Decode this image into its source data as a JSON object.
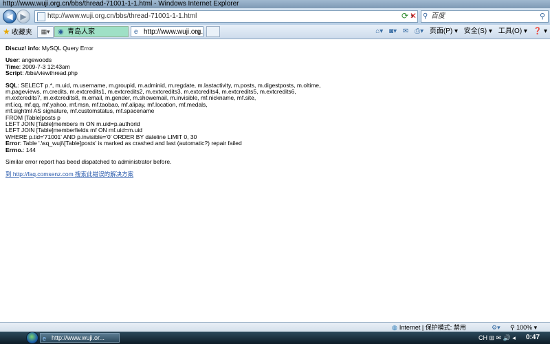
{
  "window": {
    "title": "http://www.wuji.org.cn/bbs/thread-71001-1-1.html - Windows Internet Explorer"
  },
  "nav": {
    "address": "http://www.wuji.org.cn/bbs/thread-71001-1-1.html",
    "search_placeholder": "百度"
  },
  "commandbar": {
    "favorites_label": "收藏夹",
    "tabs": [
      {
        "label": "青岛人家"
      },
      {
        "label": "http://www.wuji.org.cn..."
      }
    ],
    "page_menu": "页面(P) ▾",
    "safety_menu": "安全(S) ▾",
    "tools_menu": "工具(O) ▾",
    "help_menu": "❓ ▾"
  },
  "error": {
    "heading_label": "Discuz! info",
    "heading_value": ": MySQL Query Error",
    "user_label": "User",
    "user_value": ": angewoods",
    "time_label": "Time",
    "time_value": ": 2009-7-3 12:43am",
    "script_label": "Script",
    "script_value": ": /bbs/viewthread.php",
    "sql_label": "SQL",
    "sql_lines": [
      ": SELECT p.*, m.uid, m.username, m.groupid, m.adminid, m.regdate, m.lastactivity, m.posts, m.digestposts, m.oltime,",
      "m.pageviews, m.credits, m.extcredits1, m.extcredits2, m.extcredits3, m.extcredits4, m.extcredits5, m.extcredits6,",
      "m.extcredits7, m.extcredits8, m.email, m.gender, m.showemail, m.invisible, mf.nickname, mf.site,",
      "mf.icq, mf.qq, mf.yahoo, mf.msn, mf.taobao, mf.alipay, mf.location, mf.medals,",
      "mf.sightml AS signature, mf.customstatus, mf.spacename",
      "FROM [Table]posts p",
      "LEFT JOIN [Table]members m ON m.uid=p.authorid",
      "LEFT JOIN [Table]memberfields mf ON mf.uid=m.uid",
      "WHERE p.tid='71001' AND p.invisible='0' ORDER BY dateline LIMIT 0, 30"
    ],
    "error_label": "Error",
    "error_value": ": Table '.\\sq_wuji\\[Table]posts' is marked as crashed and last (automatic?) repair failed",
    "errno_label": "Errno.",
    "errno_value": ": 144",
    "report_text": "Similar error report has beed dispatched to administrator before.",
    "faq_link": "到 http://faq.comsenz.com 搜索此错误的解决方案"
  },
  "statusbar": {
    "zone": "Internet | 保护模式: 禁用",
    "zoom": "100%"
  },
  "taskbar": {
    "task_label": "http://www.wuji.or...",
    "tray": "CH ⊞ ✉ 🔊 ◂",
    "clock": "0:47"
  }
}
